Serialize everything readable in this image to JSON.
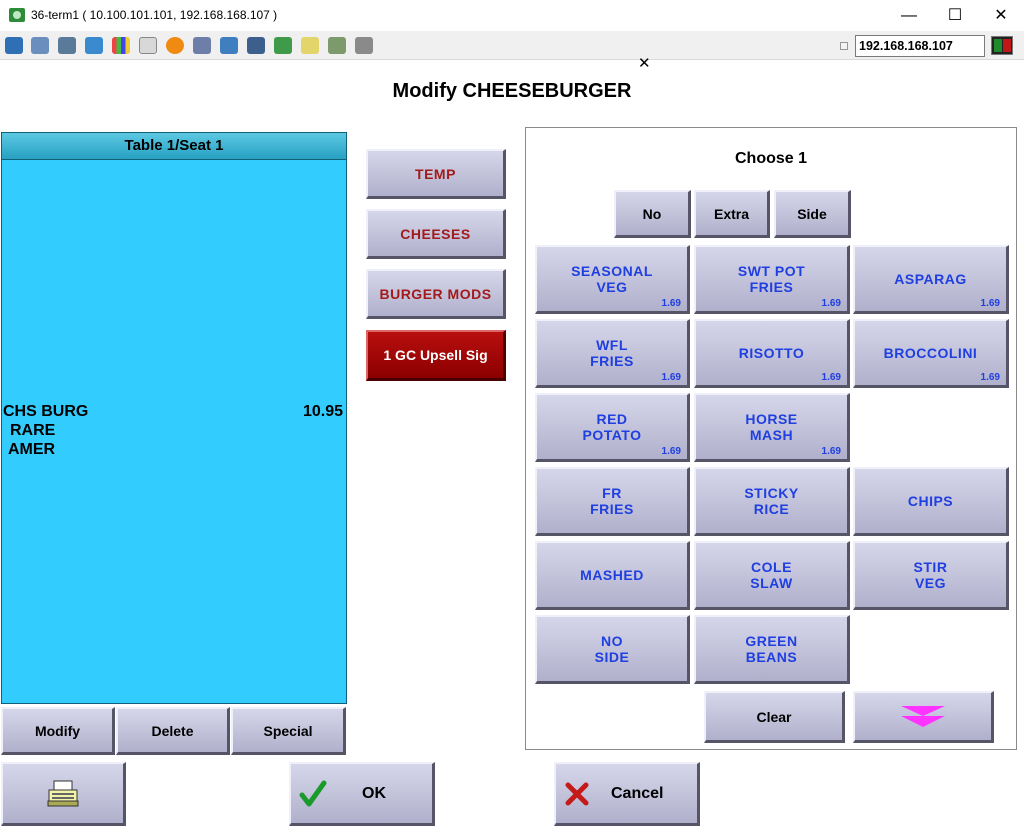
{
  "window": {
    "title": "36-term1 ( 10.100.101.101, 192.168.168.107 )",
    "controls": {
      "minimize": "—",
      "maximize": "☐",
      "close": "✕"
    }
  },
  "toolbar": {
    "icons": [
      "monitor-icon",
      "windows-icon",
      "tools-icon",
      "refresh-icon",
      "windows-flag-icon",
      "keyboard-icon",
      "alert-icon",
      "network-icon",
      "fullscreen-icon",
      "display-icon",
      "download-icon",
      "document-icon",
      "map-icon",
      "chat-icon"
    ],
    "ip_value": "192.168.168.107"
  },
  "dialog": {
    "title": "Modify CHEESEBURGER"
  },
  "check": {
    "header": "Table 1/Seat 1",
    "item_name": "CHS BURG",
    "item_price": "10.95",
    "modifiers": [
      "RARE",
      "AMER"
    ],
    "actions": {
      "modify": "Modify",
      "delete": "Delete",
      "special": "Special"
    }
  },
  "modifier_groups": {
    "temp": "TEMP",
    "cheeses": "CHEESES",
    "burger_mods": "BURGER MODS",
    "upsell": "1 GC Upsell Sig"
  },
  "choose": {
    "title": "Choose 1",
    "prefixes": {
      "no": "No",
      "extra": "Extra",
      "side": "Side"
    },
    "options": [
      {
        "label": "SEASONAL\nVEG",
        "price": "1.69"
      },
      {
        "label": "SWT POT\nFRIES",
        "price": "1.69"
      },
      {
        "label": "ASPARAG",
        "price": "1.69"
      },
      {
        "label": "WFL\nFRIES",
        "price": "1.69"
      },
      {
        "label": "RISOTTO",
        "price": "1.69"
      },
      {
        "label": "BROCCOLINI",
        "price": "1.69"
      },
      {
        "label": "RED\nPOTATO",
        "price": "1.69"
      },
      {
        "label": "HORSE\nMASH",
        "price": "1.69"
      },
      {
        "label": "FR\nFRIES",
        "price": ""
      },
      {
        "label": "STICKY\nRICE",
        "price": ""
      },
      {
        "label": "CHIPS",
        "price": ""
      },
      {
        "label": "MASHED",
        "price": ""
      },
      {
        "label": "COLE\nSLAW",
        "price": ""
      },
      {
        "label": "STIR\nVEG",
        "price": ""
      },
      {
        "label": "NO\nSIDE",
        "price": ""
      },
      {
        "label": "GREEN\nBEANS",
        "price": ""
      }
    ],
    "clear": "Clear"
  },
  "footer": {
    "ok": "OK",
    "cancel": "Cancel"
  },
  "colors": {
    "check_background": "#33ccff",
    "option_text": "#1f3fe0",
    "modifier_group_text": "#a31a1a",
    "upsell_button": "#a00000",
    "next_arrow": "#ff33ff"
  }
}
